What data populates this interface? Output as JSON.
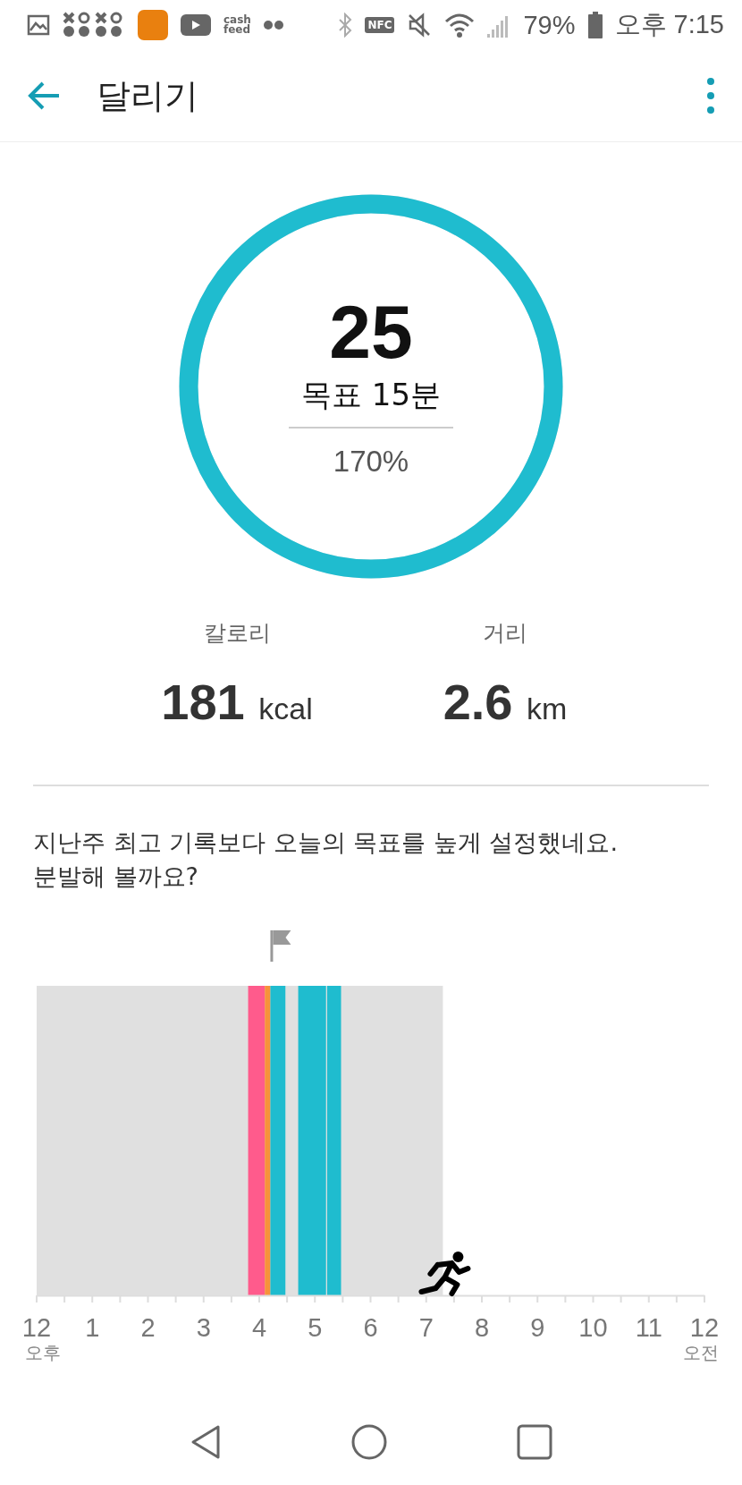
{
  "status_bar": {
    "app_logo_text": [
      "cash",
      "feed"
    ],
    "nfc": "NFC",
    "battery": "79%",
    "time": "오후 7:15"
  },
  "app_bar": {
    "title": "달리기"
  },
  "goal_ring": {
    "level": 1,
    "value": "25",
    "goal": "목표 15분",
    "percent": "170%"
  },
  "stats": [
    {
      "label": "칼로리",
      "value": "181",
      "unit": "kcal"
    },
    {
      "label": "거리",
      "value": "2.6",
      "unit": "km"
    }
  ],
  "message": "지난주 최고 기록보다 오늘의 목표를 높게 설정했네요.\n분발해 볼까요?",
  "timeline": {
    "hour_labels": [
      "12",
      "1",
      "2",
      "3",
      "4",
      "5",
      "6",
      "7",
      "8",
      "9",
      "10",
      "11",
      "12"
    ],
    "start_sublabel": "오후",
    "end_sublabel": "오전",
    "segments": [
      {
        "color": "#ff5b8c"
      },
      {
        "color": "#f7923a"
      },
      {
        "color": "#1fbccf"
      },
      {
        "color": "#1fbccf"
      },
      {
        "color": "#1fbccf"
      }
    ]
  }
}
